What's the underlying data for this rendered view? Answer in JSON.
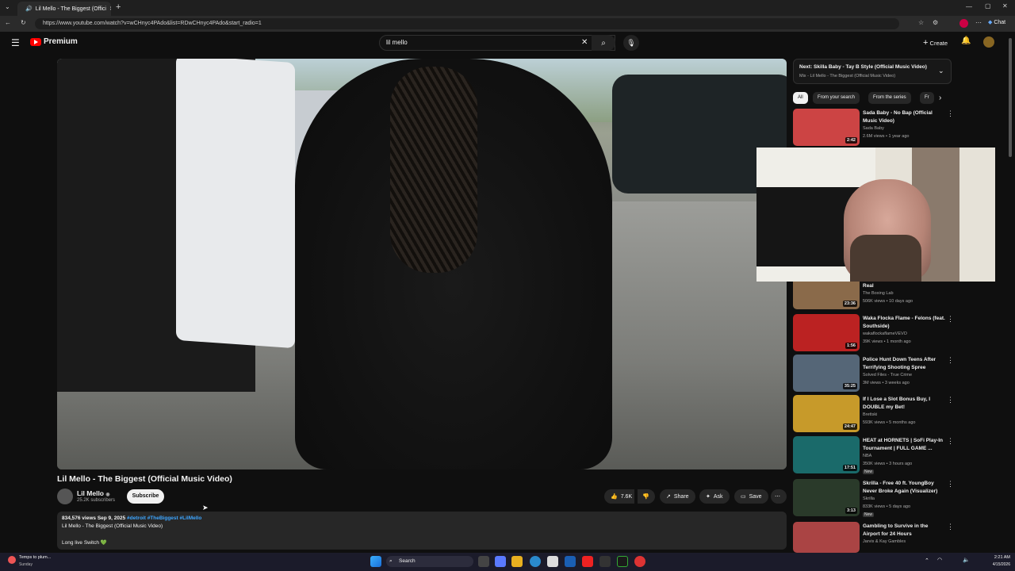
{
  "browser": {
    "tab_title": "Lil Mello - The Biggest (Offici",
    "url": "https://www.youtube.com/watch?v=wCHnyc4PAdo&list=RDwCHnyc4PAdo&start_radio=1",
    "chat_label": "Chat"
  },
  "yt_header": {
    "logo_text": "Premium",
    "search_value": "lil mello",
    "create_label": "Create"
  },
  "video": {
    "title": "Lil Mello - The Biggest (Official Music Video)",
    "channel": "Lil Mello",
    "subscribers": "25.2K subscribers",
    "subscribe_label": "Subscribe",
    "likes": "7.6K",
    "share_label": "Share",
    "ask_label": "Ask",
    "save_label": "Save",
    "views_date": "834,576 views  Sep 9, 2025",
    "hashtags": "#detroit #TheBiggest #LilMello",
    "desc_line1": "Lil Mello - The Biggest (Official Music Video)",
    "desc_line2": "Long live Switch",
    "heart": "💚"
  },
  "sidebar": {
    "next_title": "Next: Skilla Baby - Tay B Style (Official Music Video)",
    "next_sub": "Mix - Lil Mello - The Biggest (Official Music Video)",
    "chips": [
      "All",
      "From your search",
      "From the series",
      "Fr"
    ],
    "items": [
      {
        "title": "Sada Baby - No Bap (Official Music Video)",
        "channel": "Sada Baby",
        "meta": "2.6M views • 1 year ago",
        "duration": "2:42",
        "thumb": "#c44"
      },
      {
        "title": "Real",
        "channel": "The Boxing Lab",
        "meta": "506K views • 10 days ago",
        "duration": "23:36",
        "thumb": "#8a6a4a"
      },
      {
        "title": "Waka Flocka Flame - Felons (feat. Southside)",
        "channel": "wakaflockaflameVEVO",
        "meta": "39K views • 1 month ago",
        "duration": "1:56",
        "thumb": "#b22"
      },
      {
        "title": "Police Hunt Down Teens After Terrifying Shooting Spree",
        "channel": "Solved Files - True Crime",
        "meta": "3M views • 3 weeks ago",
        "duration": "35:25",
        "thumb": "#556677"
      },
      {
        "title": "If I Lose a Slot Bonus Buy, I DOUBLE my Bet!",
        "channel": "Brettski",
        "meta": "593K views • 5 months ago",
        "duration": "24:47",
        "thumb": "#c79a2a"
      },
      {
        "title": "HEAT at HORNETS | SoFi Play-In Tournament | FULL GAME ...",
        "channel": "NBA",
        "meta": "350K views • 3 hours ago",
        "duration": "17:51",
        "thumb": "#1a6a6a",
        "badge": "New"
      },
      {
        "title": "Skrilla - Free 40 ft. YoungBoy Never Broke Again (Visualizer)",
        "channel": "Skrilla",
        "meta": "833K views • 5 days ago",
        "duration": "3:13",
        "thumb": "#2a3a2a",
        "badge": "New"
      },
      {
        "title": "Gambling to Survive in the Airport for 24 Hours",
        "channel": "Jarvis & Kay Gambles",
        "meta": "857K views • 5 months ago",
        "duration": "",
        "thumb": "#aa4444"
      }
    ]
  },
  "taskbar": {
    "weather_title": "Temps to plum...",
    "weather_sub": "Sunday",
    "search_label": "Search",
    "time": "2:21 AM",
    "date": "4/15/2026"
  }
}
